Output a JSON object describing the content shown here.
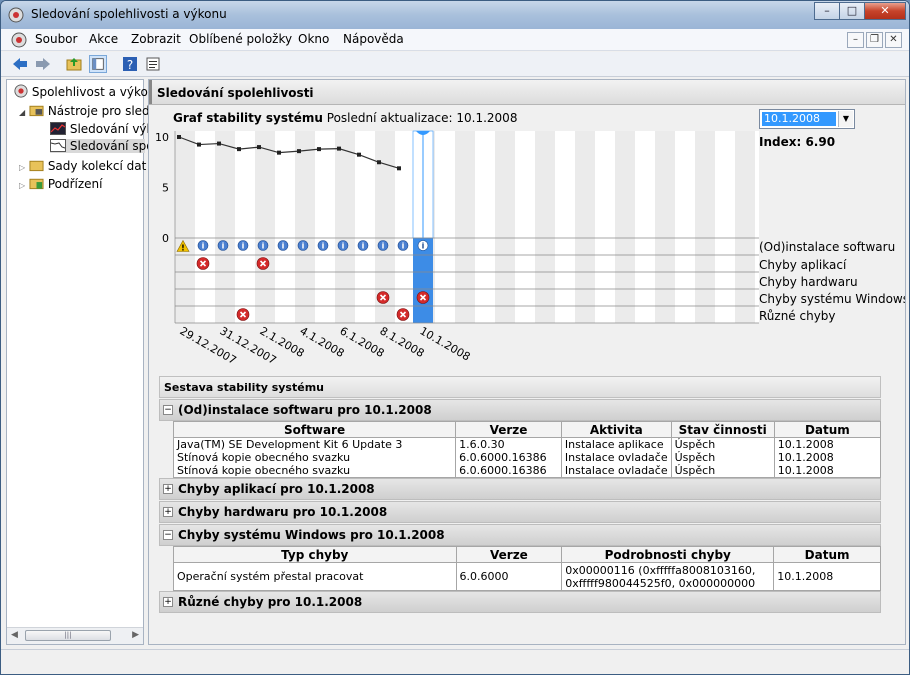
{
  "window": {
    "title": "Sledování spolehlivosti a výkonu"
  },
  "menu": [
    "Soubor",
    "Akce",
    "Zobrazit",
    "Oblíbené položky",
    "Okno",
    "Nápověda"
  ],
  "tree": [
    {
      "label": "Spolehlivost a výkon"
    },
    {
      "label": "Nástroje pro sled"
    },
    {
      "label": "Sledování výk"
    },
    {
      "label": "Sledování spo"
    },
    {
      "label": "Sady kolekcí dat"
    },
    {
      "label": "Podřízení"
    }
  ],
  "pane": {
    "title": "Sledování spolehlivosti"
  },
  "graph": {
    "title": "Graf stability systému",
    "last_update": "Poslední aktualizace: 10.1.2008",
    "selected_date": "10.1.2008",
    "index": "Index: 6.90",
    "rows": [
      "(Od)instalace softwaru",
      "Chyby aplikací",
      "Chyby hardwaru",
      "Chyby systému Windows",
      "Různé chyby"
    ],
    "y_ticks": [
      "10",
      "5",
      "0"
    ]
  },
  "chart_data": {
    "type": "line",
    "title": "Graf stability systému",
    "ylim": [
      0,
      10
    ],
    "x": [
      "29.12.2007",
      "30.12.2007",
      "31.12.2007",
      "1.1.2008",
      "2.1.2008",
      "3.1.2008",
      "4.1.2008",
      "5.1.2008",
      "6.1.2008",
      "7.1.2008",
      "8.1.2008",
      "9.1.2008",
      "10.1.2008"
    ],
    "x_tick_labels": [
      "29.12.2007",
      "31.12.2007",
      "2.1.2008",
      "4.1.2008",
      "6.1.2008",
      "8.1.2008",
      "10.1.2008"
    ],
    "values": [
      10.0,
      9.25,
      9.35,
      8.8,
      9.0,
      8.45,
      8.6,
      8.8,
      8.85,
      8.25,
      7.5,
      6.9
    ],
    "selected_index": 12,
    "events": {
      "software": [
        "warning",
        "info",
        "info",
        "info",
        "info",
        "info",
        "info",
        "info",
        "info",
        "info",
        "info",
        "info"
      ],
      "app_failures": [
        1,
        4
      ],
      "hardware_failures": [],
      "windows_failures": [
        10,
        12
      ],
      "misc_failures": [
        3,
        11
      ]
    }
  },
  "report": {
    "title": "Sestava stability systému",
    "sections": [
      {
        "label": "(Od)instalace softwaru pro 10.1.2008",
        "expanded": true
      },
      {
        "label": "Chyby aplikací pro 10.1.2008",
        "expanded": false
      },
      {
        "label": "Chyby hardwaru pro 10.1.2008",
        "expanded": false
      },
      {
        "label": "Chyby systému Windows pro 10.1.2008",
        "expanded": true
      },
      {
        "label": "Různé chyby pro 10.1.2008",
        "expanded": false
      }
    ],
    "software_headers": [
      "Software",
      "Verze",
      "Aktivita",
      "Stav činnosti",
      "Datum"
    ],
    "software_rows": [
      [
        "Java(TM) SE Development Kit 6 Update 3",
        "1.6.0.30",
        "Instalace aplikace",
        "Úspěch",
        "10.1.2008"
      ],
      [
        "Stínová kopie obecného svazku",
        "6.0.6000.16386",
        "Instalace ovladače",
        "Úspěch",
        "10.1.2008"
      ],
      [
        "Stínová kopie obecného svazku",
        "6.0.6000.16386",
        "Instalace ovladače",
        "Úspěch",
        "10.1.2008"
      ]
    ],
    "windows_headers": [
      "Typ chyby",
      "Verze",
      "Podrobnosti chyby",
      "Datum"
    ],
    "windows_rows": [
      [
        "Operační systém přestal pracovat",
        "6.0.6000",
        "0x00000116 (0xfffffa8008103160,",
        "0xfffff980044525f0, 0x000000000",
        "10.1.2008"
      ]
    ]
  }
}
